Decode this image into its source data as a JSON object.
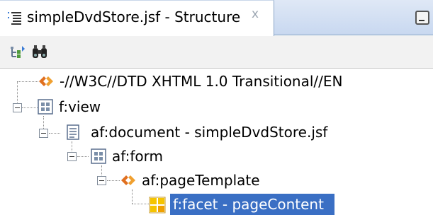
{
  "tab": {
    "title": "simpleDvdStore.jsf - Structure",
    "close_glyph": "x",
    "icon": "structure-icon"
  },
  "toolbar": {
    "buttons": [
      {
        "icon": "sync-with-editor-icon"
      },
      {
        "icon": "binoculars-icon"
      }
    ]
  },
  "tree": {
    "nodes": [
      {
        "label": "-//W3C//DTD XHTML 1.0 Transitional//EN",
        "icon": "doctype-icon"
      },
      {
        "label": "f:view",
        "icon": "component-icon"
      },
      {
        "label": "af:document - simpleDvdStore.jsf",
        "icon": "document-icon"
      },
      {
        "label": "af:form",
        "icon": "component-icon"
      },
      {
        "label": "af:pageTemplate",
        "icon": "template-icon"
      },
      {
        "label": "f:facet - pageContent",
        "icon": "facet-icon",
        "selected": true
      }
    ]
  },
  "colors": {
    "selection": "#3a6fc4",
    "tab_bar": "#c8d8f0",
    "template_orange": "#e07020",
    "facet_yellow": "#f5c400"
  }
}
